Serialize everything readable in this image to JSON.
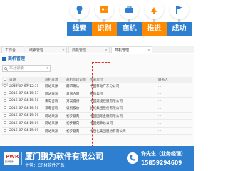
{
  "tiles": [
    {
      "label": "线索",
      "color": "#2f7fd0",
      "icon": "lightbulb-icon"
    },
    {
      "label": "识别",
      "color": "#ff8a00",
      "icon": "id-card-icon"
    },
    {
      "label": "商机",
      "color": "#2f7fd0",
      "icon": "briefcase-icon"
    },
    {
      "label": "推进",
      "color": "#ff8a00",
      "icon": "push-icon"
    },
    {
      "label": "成功",
      "color": "#2f7fd0",
      "icon": "flag-icon"
    }
  ],
  "tabs": [
    "工作台",
    "线索管理",
    "商机管理",
    "商机管理"
  ],
  "panel": {
    "breadcrumb": "商机管理",
    "search_placeholder": "本月记录",
    "columns": [
      "",
      "日期",
      "商机来源",
      "商机阶段说明",
      "往来单位",
      "联系人"
    ],
    "rows": [
      {
        "date": "2016-07-07 12:31",
        "source": "网站来源",
        "status": "需求确认",
        "company": "中国移动广东分公司",
        "contact": "..."
      },
      {
        "date": "2016-07-04 15:13",
        "source": "网站来源",
        "status": "意向合同",
        "company": "腾航集团",
        "contact": "..."
      },
      {
        "date": "2016-07-04 15:10",
        "source": "来电咨询",
        "status": "方案提供",
        "company": "中国建设控股有限公司",
        "contact": "..."
      },
      {
        "date": "2016-07-04 15:10",
        "source": "来电咨询",
        "status": "谈判报价",
        "company": "长虹集团股份有限公司",
        "contact": "..."
      },
      {
        "date": "2016-07-04 15:10",
        "source": "网站来源",
        "status": "初步意向",
        "company": "中国国际金融有限公司",
        "contact": "..."
      },
      {
        "date": "2016-07-04 15:09",
        "source": "网站来源",
        "status": "初步意向",
        "company": "中国烟草总公司",
        "contact": "..."
      },
      {
        "date": "2016-07-04 15:09",
        "source": "网站来源",
        "status": "初步意向",
        "company": "中石化集团股份有限公司",
        "contact": "..."
      }
    ]
  },
  "footer": {
    "logo_mark": "PWR",
    "logo_sub": "鹏为软件",
    "company": "厦门鹏为软件有限公司",
    "product": "主营：CRM软件产品",
    "contact": "许先生（业务经理）",
    "phone": "15859294609"
  }
}
